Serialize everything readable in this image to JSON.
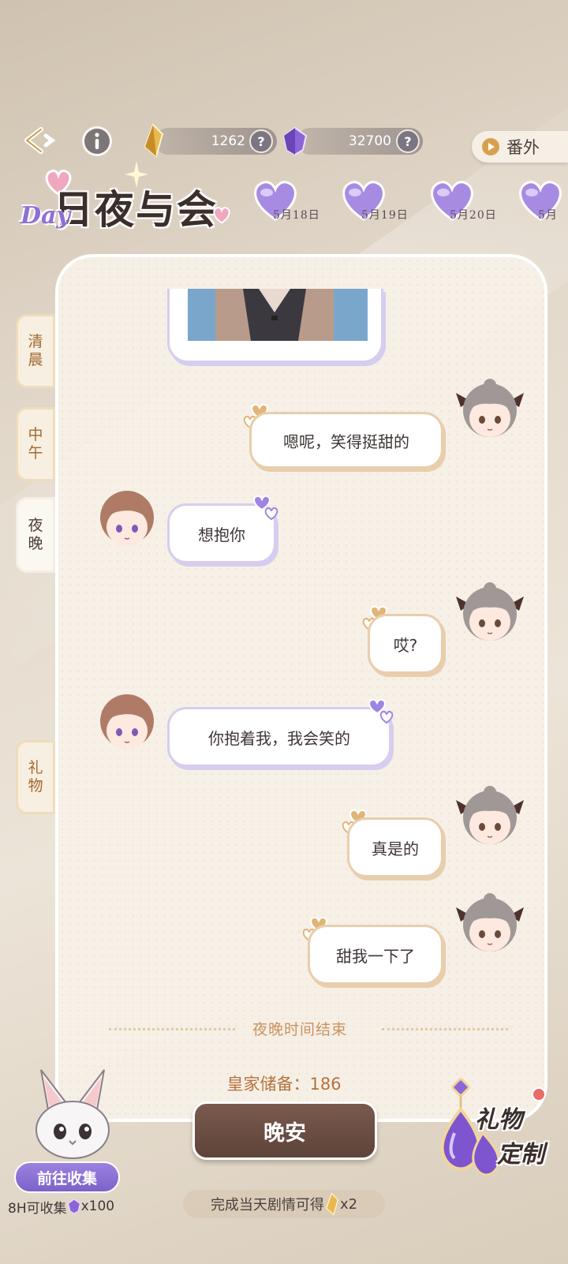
{
  "header": {
    "gold_currency": "1262",
    "gem_currency": "32700",
    "help_glyph": "?",
    "extra_button": "番外",
    "logo_title": "日夜与会",
    "logo_day": "Day"
  },
  "dates": [
    "5月18日",
    "5月19日",
    "5月20日",
    "5月"
  ],
  "side_tabs": {
    "morning": "清晨",
    "noon": "中午",
    "night": "夜晚",
    "gifts": "礼物"
  },
  "messages": [
    {
      "side": "right",
      "text": "嗯呢，笑得挺甜的"
    },
    {
      "side": "left",
      "text": "想抱你"
    },
    {
      "side": "right",
      "text": "哎?"
    },
    {
      "side": "left",
      "text": "你抱着我，我会笑的"
    },
    {
      "side": "right",
      "text": "真是的"
    },
    {
      "side": "right",
      "text": "甜我一下了"
    }
  ],
  "divider_text": "夜晚时间结束",
  "royal_reserve": "皇家储备：186",
  "goodnight_button": "晚安",
  "collect": {
    "button": "前往收集",
    "reward_prefix": "8H可收集",
    "reward_suffix": "x100"
  },
  "completion": {
    "prefix": "完成当天剧情可得",
    "suffix": "x2"
  },
  "gift_custom": {
    "line1": "礼物",
    "line2": "定制"
  },
  "colors": {
    "accent_gold": "#a2692f",
    "bubble_border_user": "#e8ceac",
    "bubble_border_partner": "#d7cdee",
    "button_brown": "#6b5046",
    "purple": "#8d6fd6"
  }
}
